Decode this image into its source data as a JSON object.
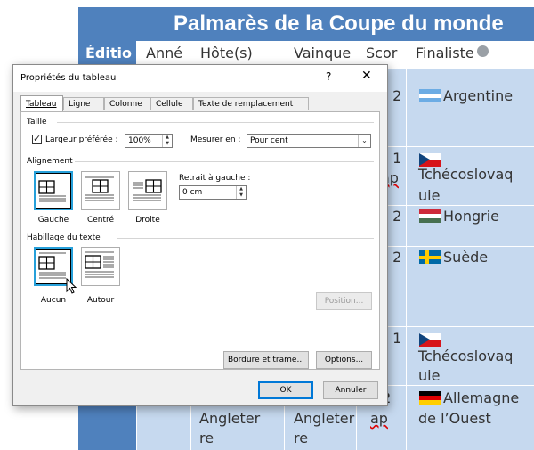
{
  "document": {
    "table_title": "Palmarès de la Coupe du monde",
    "headers": [
      "Éditio",
      "Anné",
      "Hôte(s)",
      "Vainque",
      "Scor",
      "Finaliste"
    ],
    "rows": [
      {
        "score": "– 2",
        "finalist": "Argentine",
        "flag": "argentina"
      },
      {
        "score": "– 1",
        "score2": "ap",
        "finalist_line1": "Tchécoslovaq",
        "finalist_line2": "uie",
        "flag": "czechoslovakia"
      },
      {
        "score": "– 2",
        "finalist": "Hongrie",
        "flag": "hungary"
      },
      {
        "score": "– 2",
        "finalist": "Suède",
        "flag": "sweden"
      },
      {
        "score": "– 1",
        "finalist_line1": "Tchécoslovaq",
        "finalist_line2": "uie",
        "flag": "czechoslovakia"
      },
      {
        "host_line1": "Angleter",
        "host_line2": "re",
        "winner_line1": "Angleter",
        "winner_line2": "re",
        "score": "– 2",
        "score2": "ap",
        "finalist_line1": "Allemagne",
        "finalist_line2": "de l’Ouest",
        "flag": "west-germany"
      }
    ]
  },
  "dialog": {
    "title": "Propriétés du tableau",
    "help": "?",
    "close": "✕",
    "tabs": [
      "Tableau",
      "Ligne",
      "Colonne",
      "Cellule",
      "Texte de remplacement"
    ],
    "size_section": "Taille",
    "preferred_width_label": "Largeur préférée :",
    "preferred_width_checked": true,
    "preferred_width_value": "100%",
    "measure_label": "Mesurer en :",
    "measure_value": "Pour cent",
    "alignment_section": "Alignement",
    "align_left": "Gauche",
    "align_center": "Centré",
    "align_right": "Droite",
    "indent_label": "Retrait à gauche :",
    "indent_value": "0 cm",
    "wrap_section": "Habillage du texte",
    "wrap_none": "Aucun",
    "wrap_around": "Autour",
    "position_button": "Position...",
    "borders_button": "Bordure et trame...",
    "options_button": "Options...",
    "ok_button": "OK",
    "cancel_button": "Annuler"
  }
}
